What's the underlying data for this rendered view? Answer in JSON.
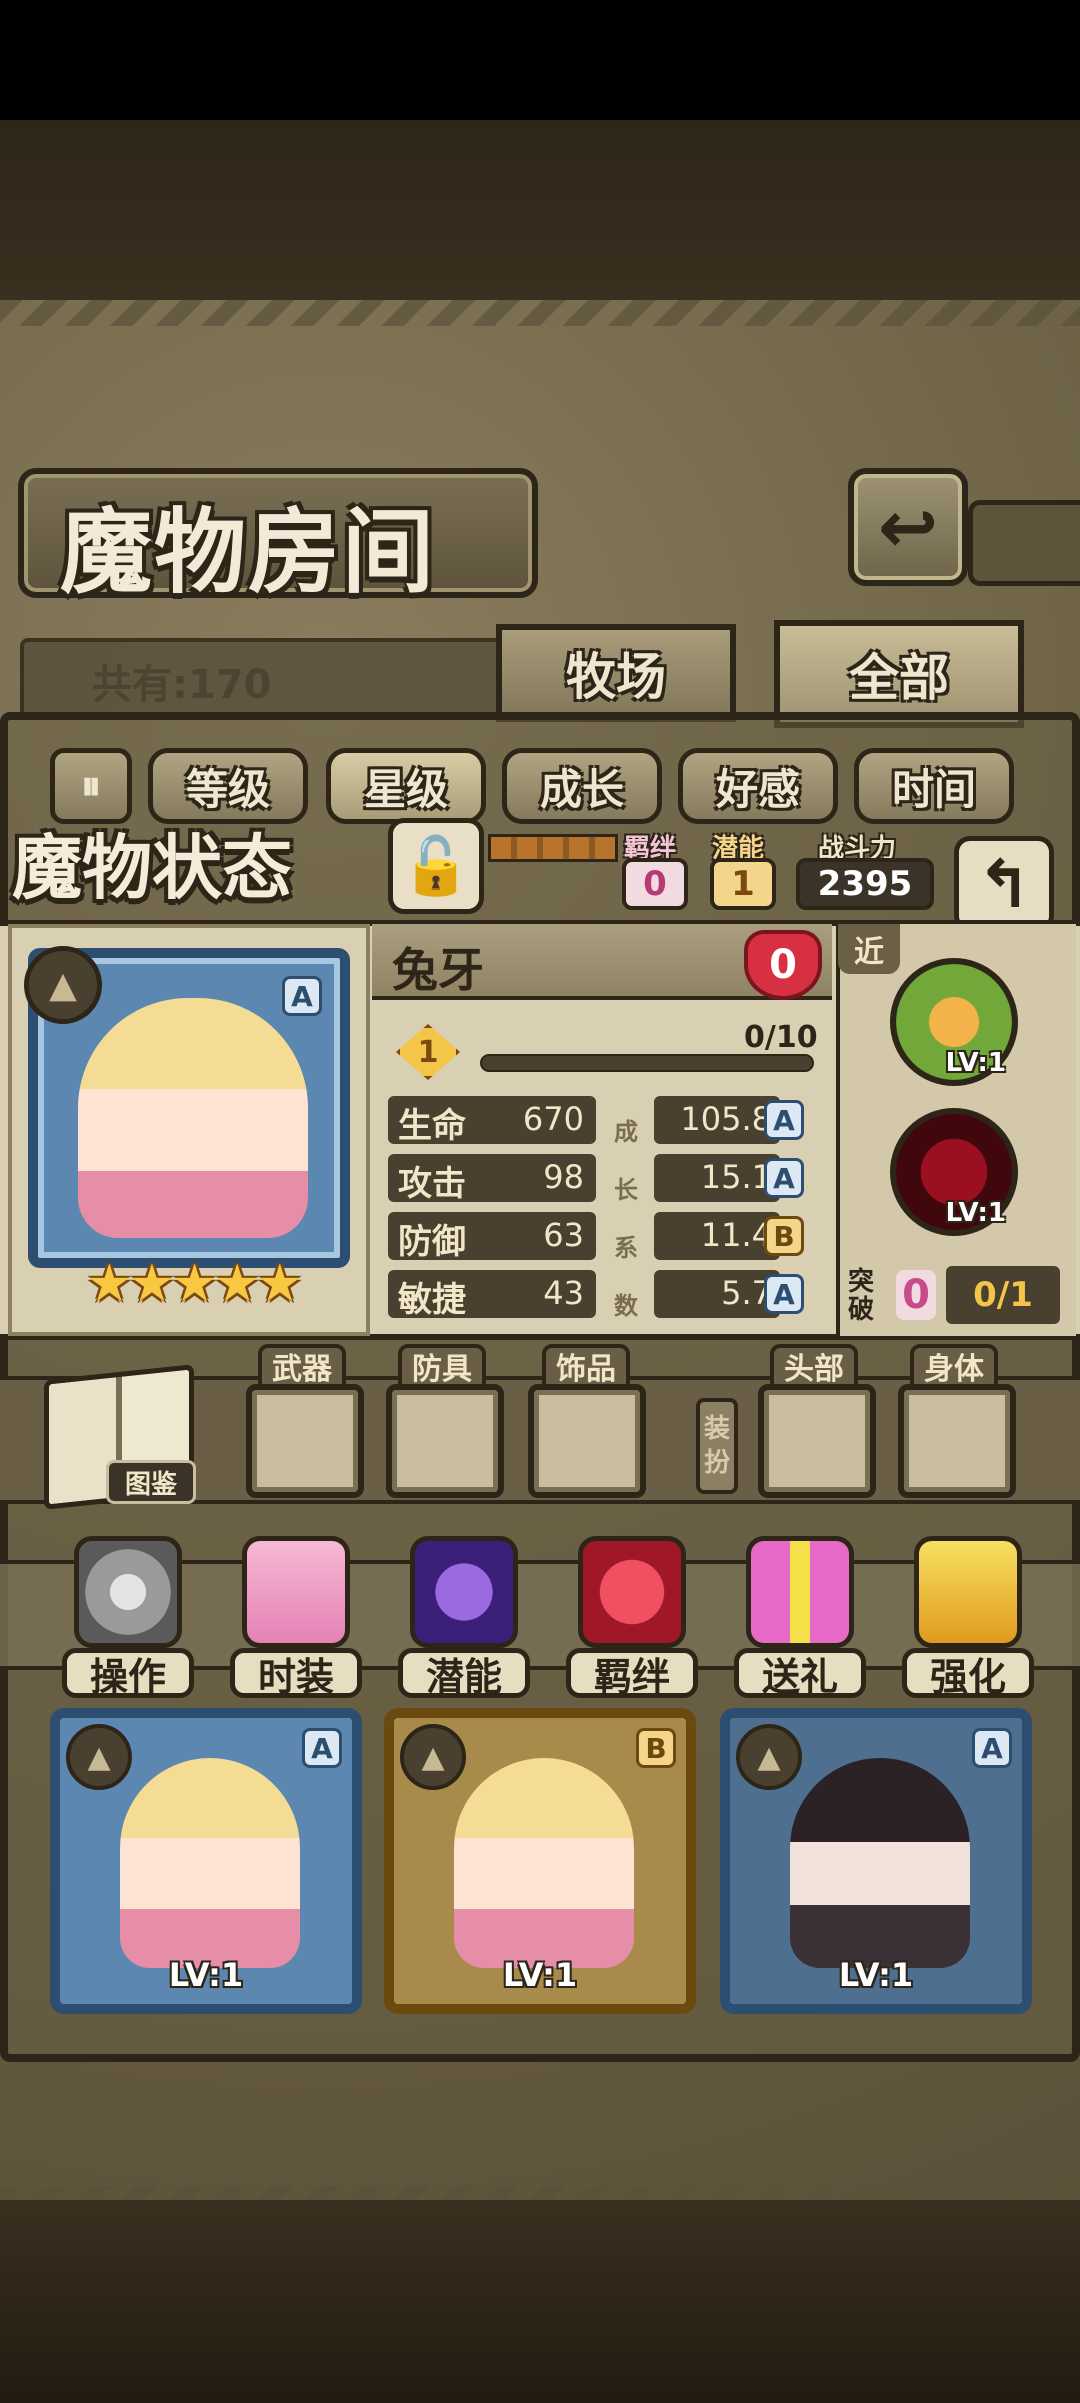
{
  "title": "魔物房间",
  "count_label": "共有:170",
  "tabs": {
    "ranch": "牧场",
    "all": "全部"
  },
  "sort": {
    "toggle_icon": "pause-sort-icon",
    "buttons": [
      "等级",
      "星级",
      "成长",
      "好感",
      "时间"
    ],
    "active_index": 1
  },
  "status": {
    "title": "魔物状态",
    "bond_label": "羁绊",
    "bond_value": "0",
    "potential_label": "潜能",
    "potential_value": "1",
    "power_label": "战斗力",
    "power_value": "2395"
  },
  "monster": {
    "name": "兔牙",
    "affection": "0",
    "level": "1",
    "exp": "0/10",
    "exp_fraction": 0,
    "grade": "A",
    "stars": "★★★★★",
    "attributes": [
      {
        "name": "生命",
        "value": "670",
        "growth": "105.8",
        "grade": "A"
      },
      {
        "name": "攻击",
        "value": "98",
        "growth": "15.1",
        "grade": "A"
      },
      {
        "name": "防御",
        "value": "63",
        "growth": "11.4",
        "grade": "B"
      },
      {
        "name": "敏捷",
        "value": "43",
        "growth": "5.7",
        "grade": "A"
      }
    ],
    "growth_label": [
      "成",
      "长",
      "系",
      "数"
    ],
    "range_tag": "近",
    "skills": [
      {
        "level": "LV:1"
      },
      {
        "level": "LV:1"
      }
    ],
    "breakthrough_label": "突破",
    "breakthrough_value": "0",
    "breakthrough_progress": "0/1"
  },
  "equipment": {
    "book_label": "图鉴",
    "slots": [
      "武器",
      "防具",
      "饰品",
      "头部",
      "身体"
    ],
    "dress_label": "装扮"
  },
  "actions": [
    "操作",
    "时装",
    "潜能",
    "羁绊",
    "送礼",
    "强化"
  ],
  "grid": [
    {
      "grade": "A",
      "level": "LV:1"
    },
    {
      "grade": "B",
      "level": "LV:1"
    },
    {
      "grade": "A",
      "level": "LV:1"
    }
  ],
  "colors": {
    "frame": "#2d2518",
    "parchment": "#d9cfb2",
    "gold": "#f3c64a",
    "heart": "#d83043"
  }
}
